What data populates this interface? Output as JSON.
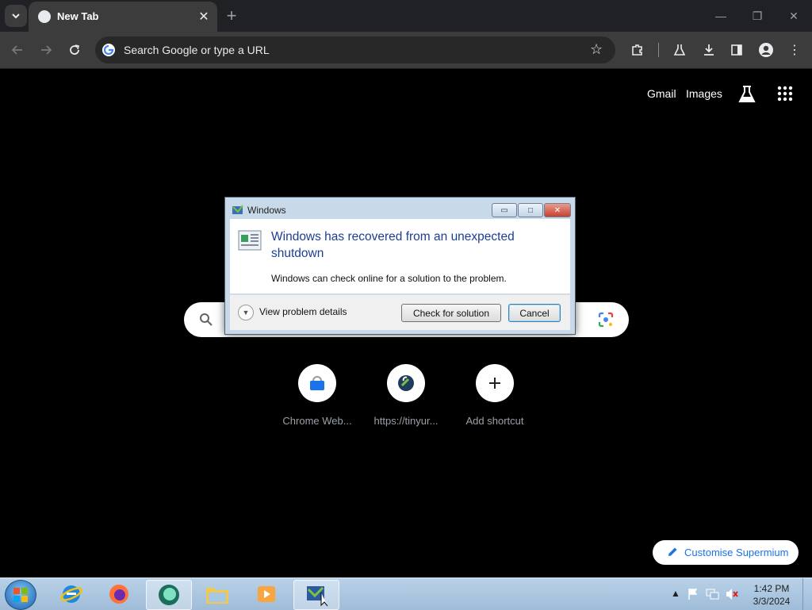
{
  "browser": {
    "tab_title": "New Tab",
    "omnibox_placeholder": "Search Google or type a URL",
    "icons": {
      "tab_search": "chevron-down-icon",
      "close": "close-icon",
      "new_tab": "plus-icon",
      "back": "arrow-left-icon",
      "forward": "arrow-right-icon",
      "reload": "reload-icon",
      "bookmark": "star-icon",
      "extensions": "puzzle-icon",
      "labs": "flask-icon",
      "downloads": "download-icon",
      "side_panel": "side-panel-icon",
      "profile": "profile-icon",
      "menu": "kebab-menu-icon"
    }
  },
  "ntp": {
    "links": [
      "Gmail",
      "Images"
    ],
    "shortcuts": [
      {
        "label": "Chrome Web..."
      },
      {
        "label": "https://tinyur..."
      },
      {
        "label": "Add shortcut"
      }
    ],
    "customise_label": "Customise Supermium"
  },
  "dialog": {
    "title": "Windows",
    "heading": "Windows has recovered from an unexpected shutdown",
    "message": "Windows can check online for a solution to the problem.",
    "details_label": "View problem details",
    "primary_button": "Check for solution",
    "cancel_button": "Cancel"
  },
  "taskbar": {
    "apps": [
      "internet-explorer",
      "firefox",
      "browser-active",
      "file-explorer",
      "media-player",
      "remote-desktop"
    ],
    "time": "1:42 PM",
    "date": "3/3/2024"
  },
  "colors": {
    "accent": "#1a73e8",
    "dialog_heading": "#1c3e93",
    "chrome_dark": "#202124"
  }
}
